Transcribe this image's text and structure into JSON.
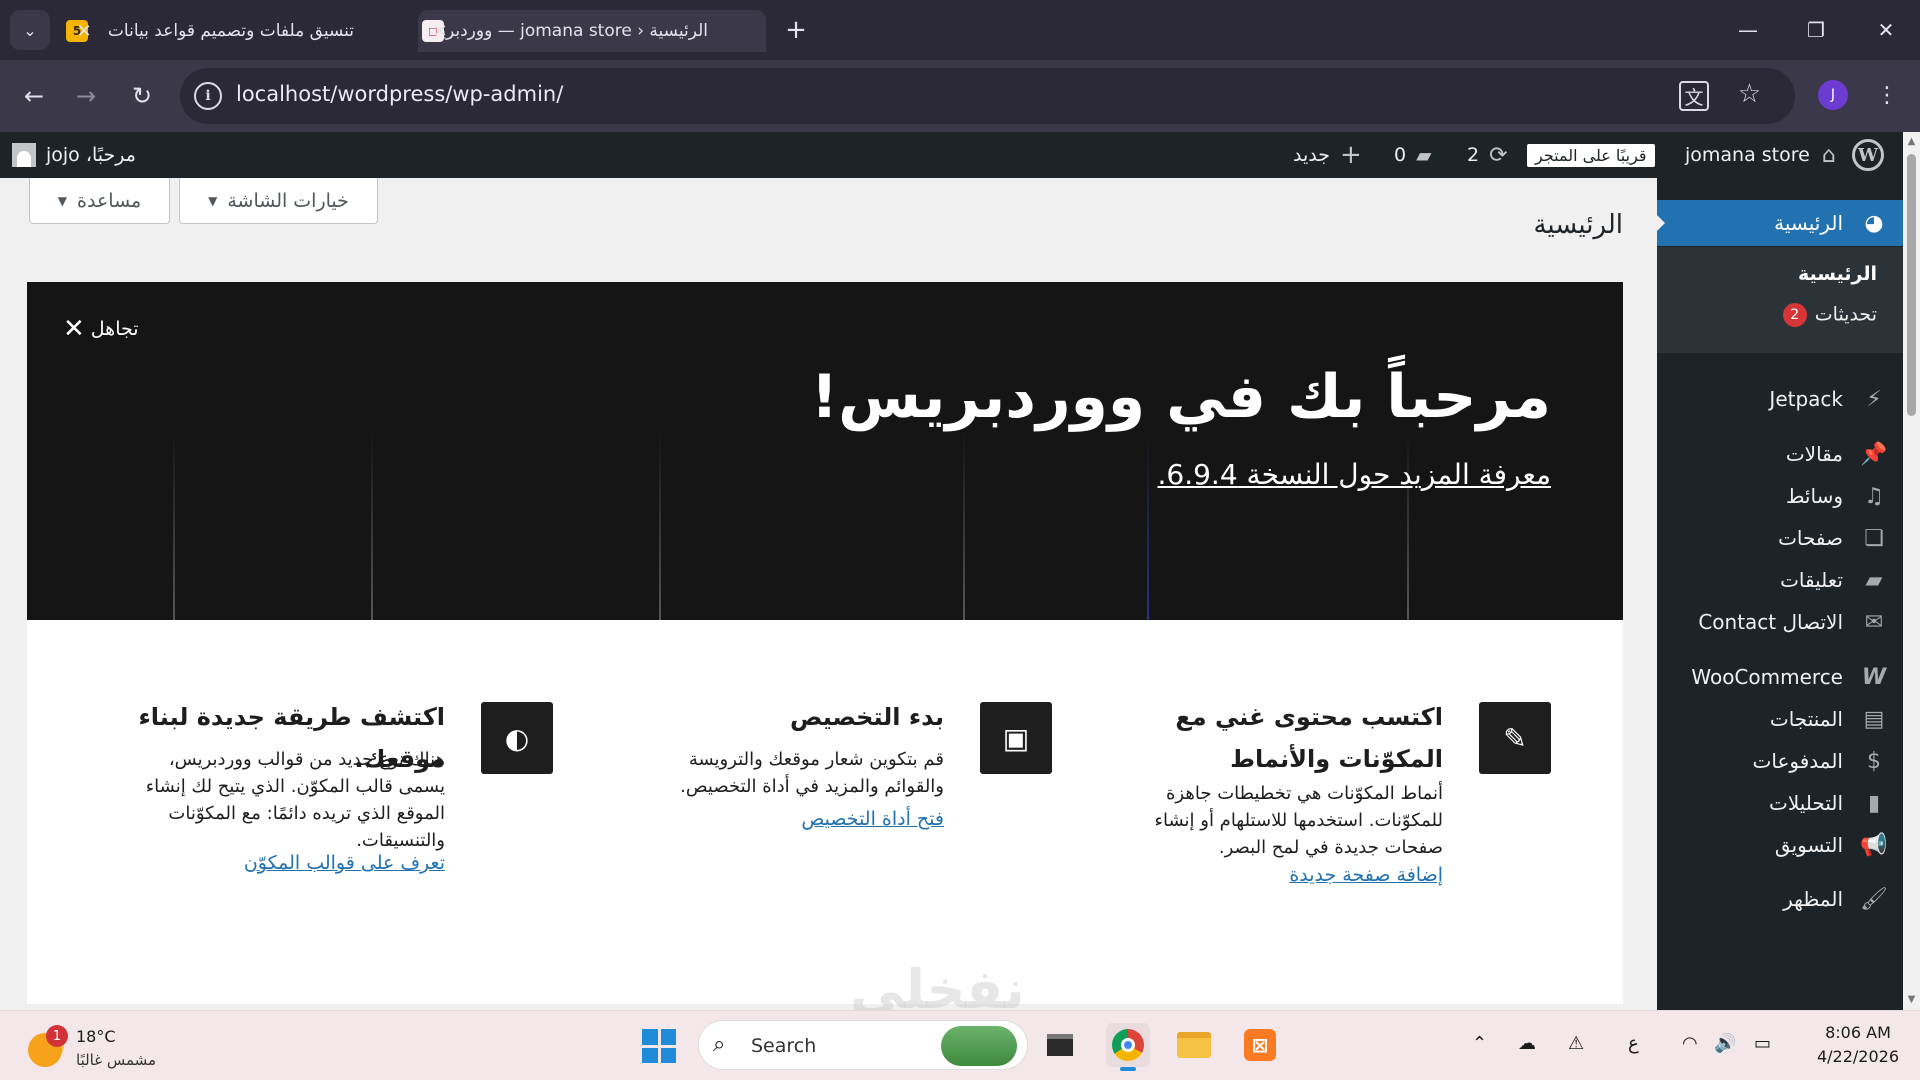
{
  "browser": {
    "tabs": [
      {
        "title": "تنسيق ملفات وتصميم قواعد بيانات",
        "favicon": "5"
      },
      {
        "title": "الرئيسية ‹ jomana store — ووردبريس",
        "favicon": "square"
      }
    ],
    "url": "localhost/wordpress/wp-admin/",
    "profile_initial": "J"
  },
  "adminbar": {
    "site_name": "jomana store",
    "coming_soon": "قريبًا على المتجر",
    "updates_count": "2",
    "comments_count": "0",
    "new_label": "جديد",
    "greeting": "مرحبًا، jojo"
  },
  "sidebar": {
    "dashboard": "الرئيسية",
    "sub_home": "الرئيسية",
    "sub_updates": "تحديثات",
    "updates_badge": "2",
    "items": [
      {
        "label": "Jetpack",
        "icon": "jetpack-icon"
      },
      {
        "label": "مقالات",
        "icon": "pin-icon"
      },
      {
        "label": "وسائط",
        "icon": "media-icon"
      },
      {
        "label": "صفحات",
        "icon": "pages-icon"
      },
      {
        "label": "تعليقات",
        "icon": "comment-icon"
      },
      {
        "label": "الاتصال Contact",
        "icon": "mail-icon"
      },
      {
        "label": "WooCommerce",
        "icon": "woo-icon"
      },
      {
        "label": "المنتجات",
        "icon": "archive-icon"
      },
      {
        "label": "المدفوعات",
        "icon": "payments-icon"
      },
      {
        "label": "التحليلات",
        "icon": "chart-icon"
      },
      {
        "label": "التسويق",
        "icon": "megaphone-icon"
      },
      {
        "label": "المظهر",
        "icon": "brush-icon"
      }
    ]
  },
  "content": {
    "screen_options": "خيارات الشاشة",
    "help": "مساعدة",
    "page_title": "الرئيسية",
    "welcome": {
      "dismiss": "تجاهل",
      "title": "مرحباً بك في ووردبريس!",
      "link": "معرفة المزيد حول النسخة 6.9.4."
    },
    "columns": [
      {
        "title": "اكتسب محتوى غني مع المكوّنات والأنماط",
        "text": "أنماط المكوّنات هي تخطيطات جاهزة للمكوّنات. استخدمها للاستلهام أو إنشاء صفحات جديدة في لمح البصر.",
        "link": "إضافة صفحة جديدة"
      },
      {
        "title": "بدء التخصيص",
        "text": "قم بتكوين شعار موقعك والترويسة والقوائم والمزيد في أداة التخصيص.",
        "link": "فتح أداة التخصيص"
      },
      {
        "title": "اكتشف طريقة جديدة لبناء موقعك.",
        "text": "هناك نوع جديد من قوالب ووردبريس، يسمى قالب المكوّن. الذي يتيح لك إنشاء الموقع الذي تريده دائمًا: مع المكوّنات والتنسيقات.",
        "link": "تعرف على قوالب المكوّن"
      }
    ]
  },
  "taskbar": {
    "temperature": "18°C",
    "weather": "مشمس غالبًا",
    "weather_badge": "1",
    "search": "Search",
    "lang": "ع",
    "time": "8:06 AM",
    "date": "4/22/2026"
  },
  "watermark": "نفخلي"
}
